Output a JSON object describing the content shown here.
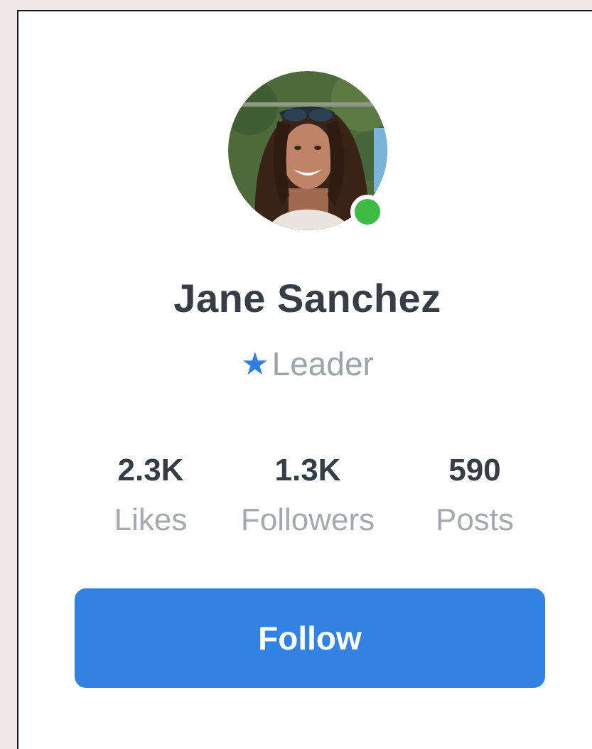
{
  "profile": {
    "avatar_icon": "profile-photo",
    "status_color": "#3fbb45",
    "name": "Jane Sanchez",
    "role_icon": "star-icon",
    "role_star_glyph": "★",
    "role": "Leader"
  },
  "stats": [
    {
      "value": "2.3K",
      "label": "Likes"
    },
    {
      "value": "1.3K",
      "label": "Followers"
    },
    {
      "value": "590",
      "label": "Posts"
    }
  ],
  "actions": {
    "follow_label": "Follow"
  },
  "colors": {
    "accent": "#3182e3",
    "online": "#3fbb45",
    "name_text": "#363d45",
    "muted_text": "#9ea3a8"
  }
}
